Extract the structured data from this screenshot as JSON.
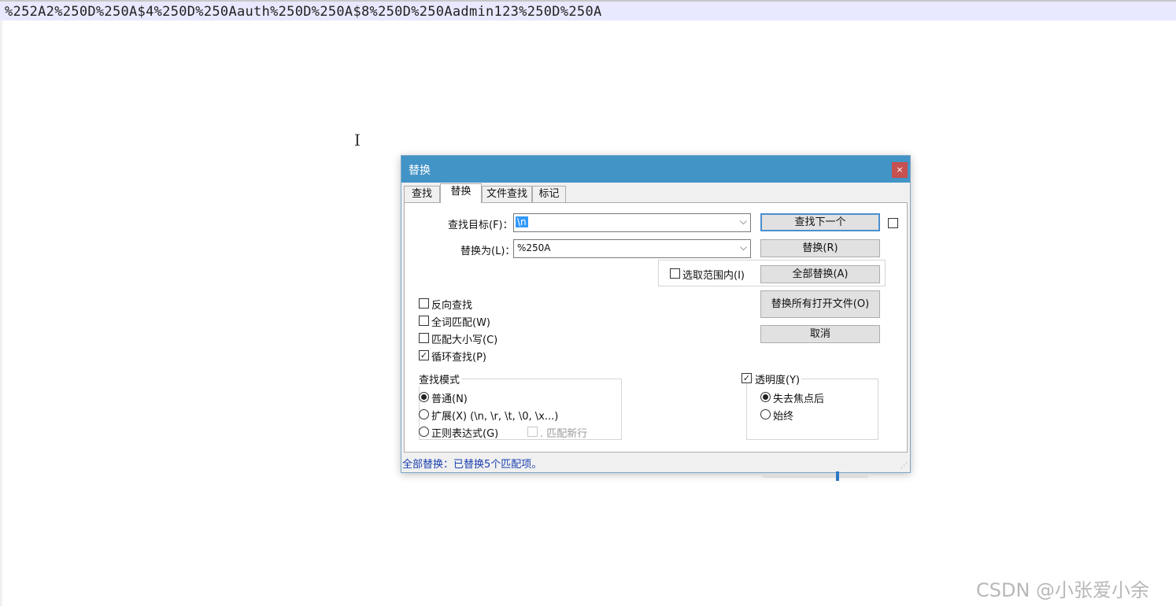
{
  "editor": {
    "line_text": "%252A2%250D%250A$4%250D%250Aauth%250D%250A$8%250D%250Aadmin123%250D%250A"
  },
  "dialog": {
    "title": "替换",
    "close_label": "×",
    "tabs": [
      "查找",
      "替换",
      "文件查找",
      "标记"
    ],
    "find_label": "查找目标(F)：",
    "find_value": "\\n",
    "replace_label": "替换为(L)：",
    "replace_value": "%250A",
    "in_selection_label": "选取范围内(I)",
    "buttons": {
      "find_next": "查找下一个",
      "replace": "替换(R)",
      "replace_all": "全部替换(A)",
      "replace_all_open": "替换所有打开文件(O)",
      "cancel": "取消"
    },
    "options": {
      "backward": "反向查找",
      "whole_word": "全词匹配(W)",
      "match_case": "匹配大小写(C)",
      "wrap_around": "循环查找(P)"
    },
    "search_mode": {
      "title": "查找模式",
      "normal": "普通(N)",
      "extended": "扩展(X) (\\n, \\r, \\t, \\0, \\x...)",
      "regex": "正则表达式(G)",
      "dot_newline": ". 匹配新行"
    },
    "transparency": {
      "label": "透明度(Y)",
      "on_lose_focus": "失去焦点后",
      "always": "始终",
      "level": 0.7
    },
    "status": "全部替换：已替换5个匹配项。"
  },
  "watermark": "CSDN @小张爱小余",
  "colors": {
    "titlebar": "#4293c6",
    "close": "#c75050",
    "status_text": "#1a3fb0",
    "line_highlight": "#e8e8ff"
  }
}
